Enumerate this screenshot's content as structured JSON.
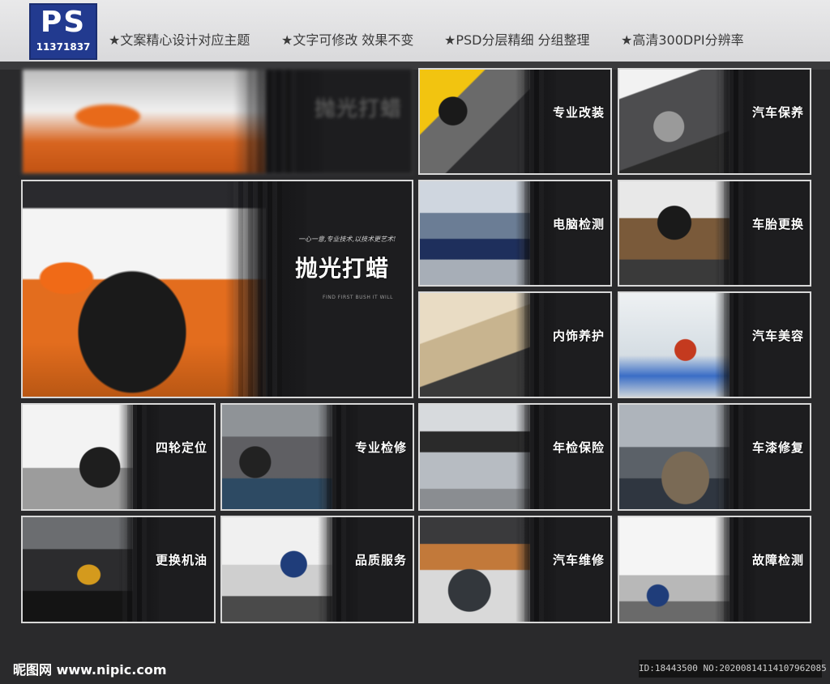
{
  "header": {
    "logo_text": "PS",
    "logo_number": "11371837",
    "features": [
      "★文案精心设计对应主题",
      "★文字可修改 效果不变",
      "★PSD分层精细 分组整理",
      "★高清300DPI分辨率"
    ]
  },
  "main_card": {
    "script": "一心一意,专业技术,以技术更艺术!",
    "title": "抛光打蜡",
    "sub_title": "FIND FIRST BUSH IT WILL"
  },
  "top_blur_title": "抛光打蜡",
  "cards": [
    {
      "title": "专业改装"
    },
    {
      "title": "汽车保养"
    },
    {
      "title": "电脑检测"
    },
    {
      "title": "车胎更换"
    },
    {
      "title": "内饰养护"
    },
    {
      "title": "汽车美容"
    },
    {
      "title": "四轮定位"
    },
    {
      "title": "专业检修"
    },
    {
      "title": "年检保险"
    },
    {
      "title": "车漆修复"
    },
    {
      "title": "更换机油"
    },
    {
      "title": "品质服务"
    },
    {
      "title": "汽车维修"
    },
    {
      "title": "故障检测"
    }
  ],
  "footer": {
    "site_logo": "昵图网 www.nipic.com",
    "id_text": "ID:18443500 NO:20200814114107962085"
  }
}
